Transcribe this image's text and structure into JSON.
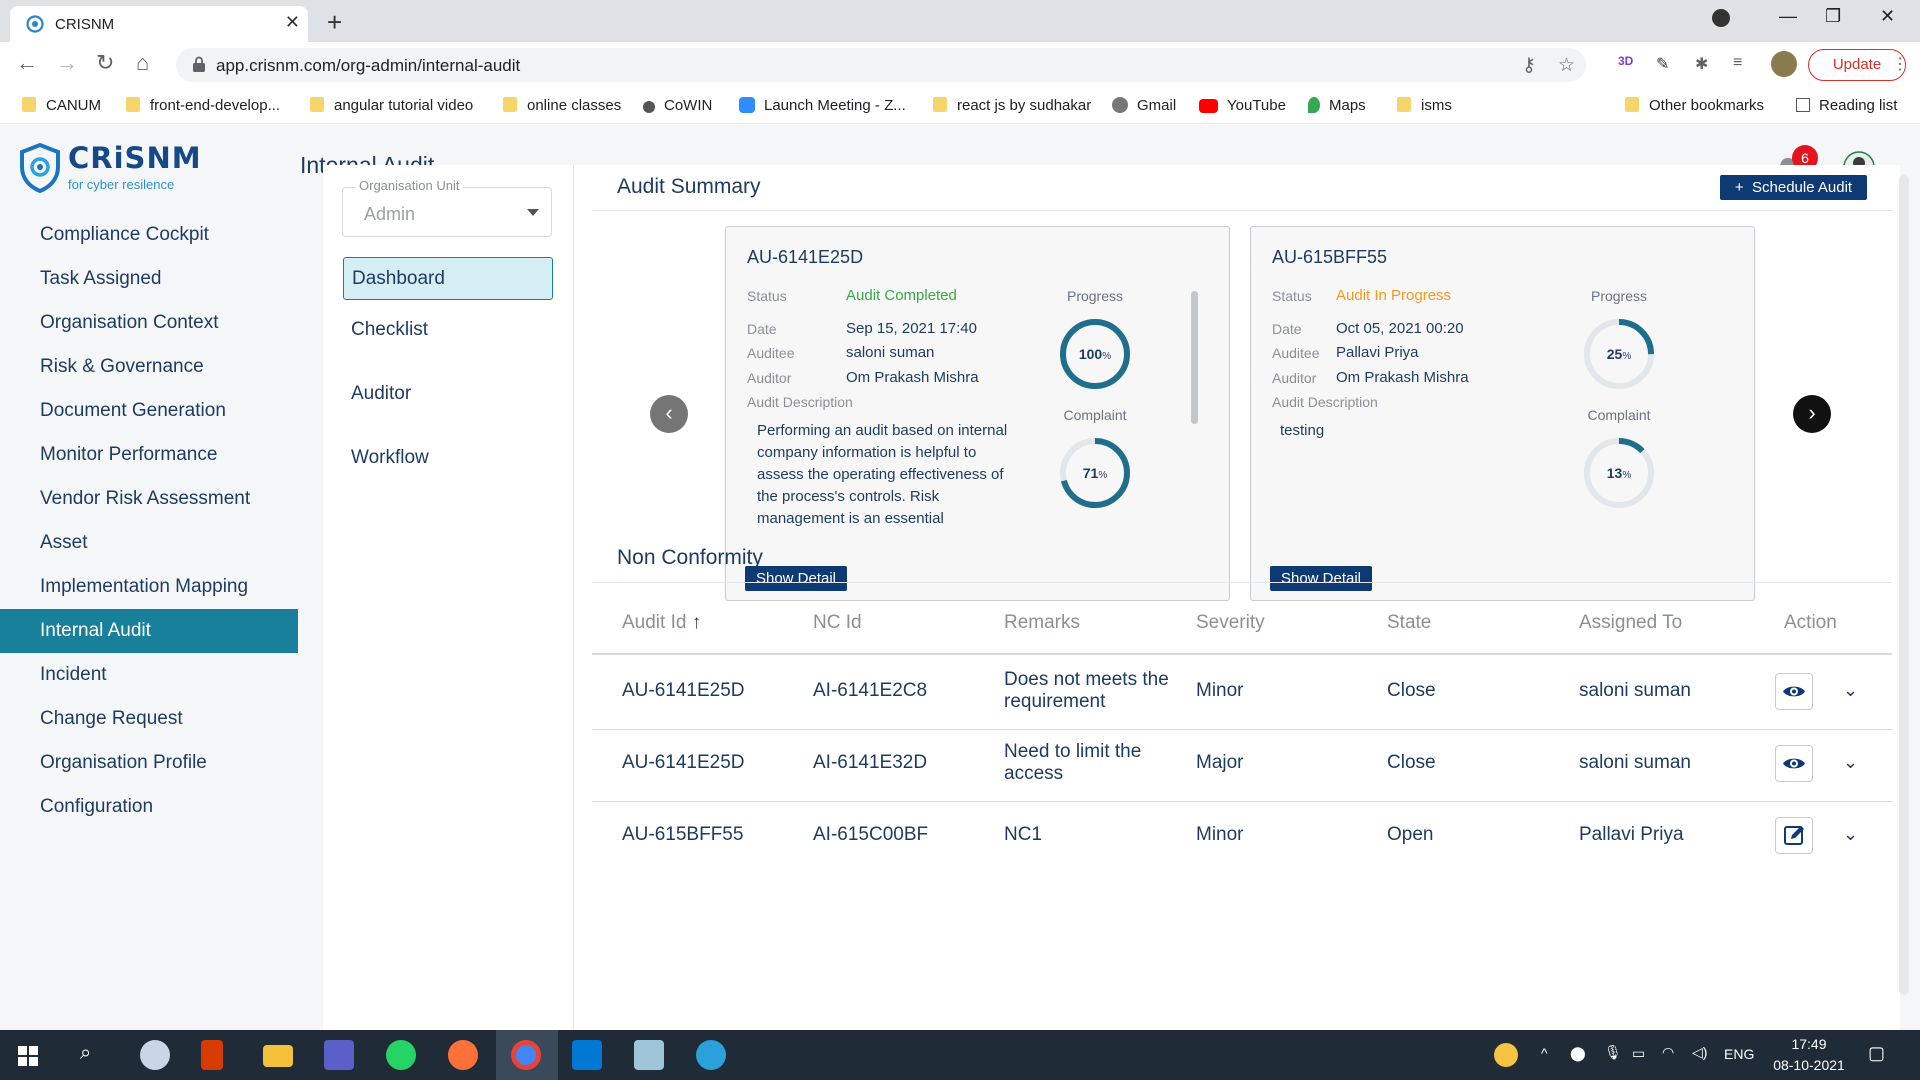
{
  "browser": {
    "tab_title": "CRISNM",
    "url": "app.crisnm.com/org-admin/internal-audit",
    "update_label": "Update",
    "bookmarks": [
      "CANUM",
      "front-end-develop...",
      "angular tutorial video",
      "online classes",
      "CoWIN",
      "Launch Meeting - Z...",
      "react js by sudhakar",
      "Gmail",
      "YouTube",
      "Maps",
      "isms"
    ],
    "other_bookmarks": "Other bookmarks",
    "reading_list": "Reading list"
  },
  "app": {
    "brand_name": "CRiSNM",
    "brand_tagline": "for cyber resilence",
    "page_title": "Internal Audit",
    "notification_count": "6"
  },
  "sidenav": {
    "items": [
      "Compliance Cockpit",
      "Task Assigned",
      "Organisation Context",
      "Risk & Governance",
      "Document Generation",
      "Monitor Performance",
      "Vendor Risk Assessment",
      "Asset",
      "Implementation Mapping",
      "Internal Audit",
      "Incident",
      "Change Request",
      "Organisation Profile",
      "Configuration"
    ],
    "active": "Internal Audit"
  },
  "subpanel": {
    "org_unit_label": "Organisation Unit",
    "org_unit_value": "Admin",
    "items": [
      "Dashboard",
      "Checklist",
      "Auditor",
      "Workflow"
    ],
    "active": "Dashboard"
  },
  "summary": {
    "title": "Audit Summary",
    "schedule_label": "Schedule Audit",
    "labels": {
      "status": "Status",
      "date": "Date",
      "auditee": "Auditee",
      "auditor": "Auditor",
      "description": "Audit Description",
      "progress": "Progress",
      "complaint": "Complaint",
      "show_detail": "Show Detail"
    },
    "cards": [
      {
        "id": "AU-6141E25D",
        "status": "Audit Completed",
        "status_color": "#3aa84a",
        "date": "Sep 15, 2021 17:40",
        "auditee": "saloni suman",
        "auditor": "Om Prakash Mishra",
        "description": "Performing an audit based on internal company information is helpful to assess the operating effectiveness of the process's controls. Risk management is an essential component of any ...",
        "progress": 100,
        "complaint": 71
      },
      {
        "id": "AU-615BFF55",
        "status": "Audit In Progress",
        "status_color": "#f39a1c",
        "date": "Oct 05, 2021 00:20",
        "auditee": "Pallavi Priya",
        "auditor": "Om Prakash Mishra",
        "description": "testing",
        "progress": 25,
        "complaint": 13
      }
    ]
  },
  "nonconformity": {
    "title": "Non Conformity",
    "headers": [
      "Audit Id",
      "NC Id",
      "Remarks",
      "Severity",
      "State",
      "Assigned To",
      "Action"
    ],
    "rows": [
      {
        "audit_id": "AU-6141E25D",
        "nc_id": "AI-6141E2C8",
        "remarks": "Does not meets the requirement",
        "severity": "Minor",
        "state": "Close",
        "assigned_to": "saloni suman",
        "action_icon": "eye-icon"
      },
      {
        "audit_id": "AU-6141E25D",
        "nc_id": "AI-6141E32D",
        "remarks": "Need to limit the access",
        "severity": "Major",
        "state": "Close",
        "assigned_to": "saloni suman",
        "action_icon": "eye-icon"
      },
      {
        "audit_id": "AU-615BFF55",
        "nc_id": "AI-615C00BF",
        "remarks": "NC1",
        "severity": "Minor",
        "state": "Open",
        "assigned_to": "Pallavi Priya",
        "action_icon": "edit-icon"
      }
    ]
  },
  "taskbar": {
    "language": "ENG",
    "time": "17:49",
    "date": "08-10-2021"
  },
  "colors": {
    "primary": "#0d3a73",
    "active_nav": "#19809c",
    "ring": "#1f6e8c"
  }
}
